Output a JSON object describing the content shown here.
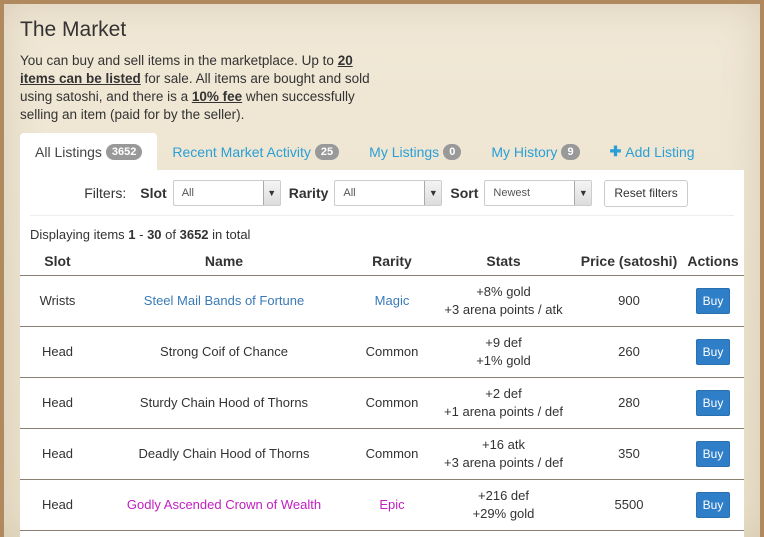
{
  "page": {
    "title": "The Market",
    "intro": {
      "p1": "You can buy and sell items in the marketplace. Up to ",
      "b1": "20 items can be listed",
      "p2": " for sale. All items are bought and sold using satoshi, and there is a ",
      "b2": "10% fee",
      "p3": " when successfully selling an item (paid for by the seller)."
    }
  },
  "tabs": [
    {
      "label": "All Listings",
      "badge": "3652"
    },
    {
      "label": "Recent Market Activity",
      "badge": "25"
    },
    {
      "label": "My Listings",
      "badge": "0"
    },
    {
      "label": "My History",
      "badge": "9"
    },
    {
      "label": "Add Listing",
      "icon": "plus-icon"
    }
  ],
  "filters": {
    "label": "Filters:",
    "slot_label": "Slot",
    "slot_value": "All",
    "rarity_label": "Rarity",
    "rarity_value": "All",
    "sort_label": "Sort",
    "sort_value": "Newest",
    "reset_label": "Reset filters"
  },
  "summary": {
    "prefix": "Displaying items ",
    "from": "1",
    "dash": " - ",
    "to": "30",
    "of": " of ",
    "total": "3652",
    "suffix": " in total"
  },
  "table": {
    "headers": [
      "Slot",
      "Name",
      "Rarity",
      "Stats",
      "Price (satoshi)",
      "Actions"
    ],
    "rows": [
      {
        "slot": "Wrists",
        "name": "Steel Mail Bands of Fortune",
        "rarity": "Magic",
        "stat1": "+8% gold",
        "stat2": "+3 arena points / atk",
        "price": "900",
        "action": "Buy"
      },
      {
        "slot": "Head",
        "name": "Strong Coif of Chance",
        "rarity": "Common",
        "stat1": "+9 def",
        "stat2": "+1% gold",
        "price": "260",
        "action": "Buy"
      },
      {
        "slot": "Head",
        "name": "Sturdy Chain Hood of Thorns",
        "rarity": "Common",
        "stat1": "+2 def",
        "stat2": "+1 arena points / def",
        "price": "280",
        "action": "Buy"
      },
      {
        "slot": "Head",
        "name": "Deadly Chain Hood of Thorns",
        "rarity": "Common",
        "stat1": "+16 atk",
        "stat2": "+3 arena points / def",
        "price": "350",
        "action": "Buy"
      },
      {
        "slot": "Head",
        "name": "Godly Ascended Crown of Wealth",
        "rarity": "Epic",
        "stat1": "+216 def",
        "stat2": "+29% gold",
        "price": "5500",
        "action": "Buy"
      }
    ]
  },
  "colors": {
    "link": "#2a9fd6",
    "magic": "#3a7ab8",
    "epic": "#c020c0",
    "buy_button": "#2f7ec8",
    "badge": "#999999"
  }
}
